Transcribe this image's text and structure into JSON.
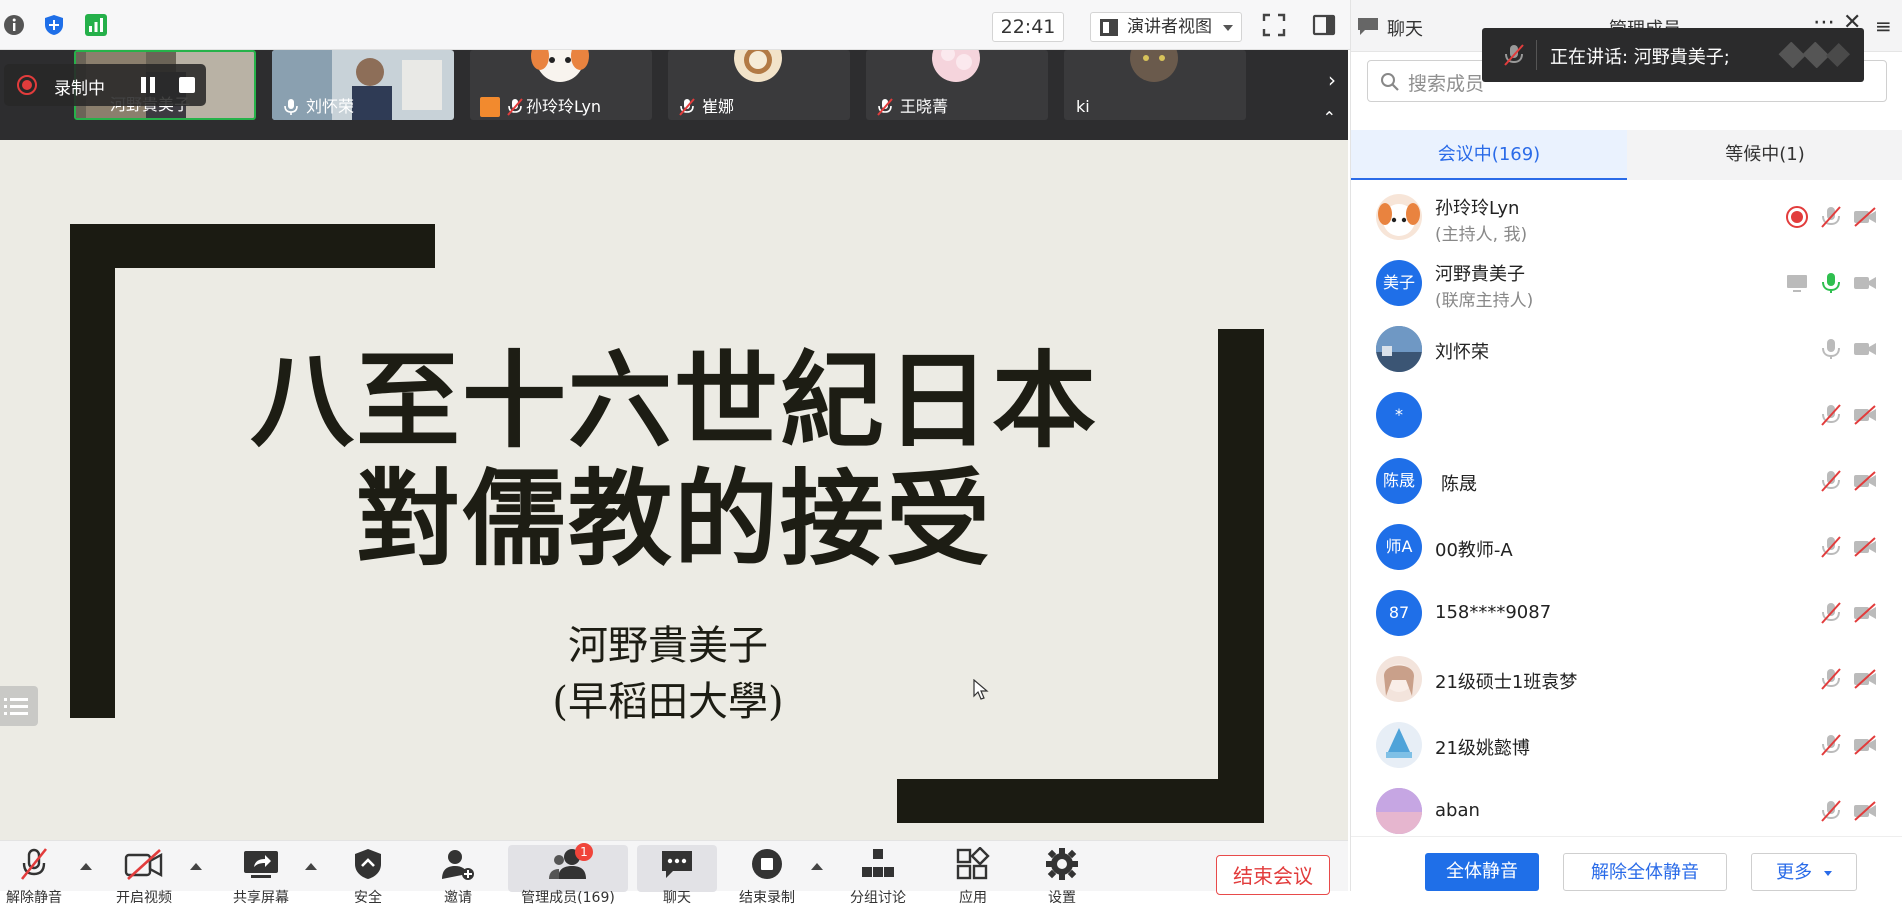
{
  "topbar": {
    "time": "22:41",
    "view_label": "演讲者视图"
  },
  "recording": {
    "label": "录制中"
  },
  "video_strip": {
    "tiles": [
      {
        "name": "河野貴美子"
      },
      {
        "name": "刘怀荣"
      },
      {
        "name": "孙玲玲Lyn"
      },
      {
        "name": "崔娜"
      },
      {
        "name": "王晓菁"
      },
      {
        "name": "ki"
      }
    ]
  },
  "slide": {
    "title_line1": "八至十六世紀日本",
    "title_line2": "對儒教的接受",
    "author": "河野貴美子",
    "affiliation": "(早稻田大學)"
  },
  "toolbar": {
    "buttons": [
      {
        "label": "解除静音"
      },
      {
        "label": "开启视频"
      },
      {
        "label": "共享屏幕"
      },
      {
        "label": "安全"
      },
      {
        "label": "邀请"
      },
      {
        "label": "管理成员(169)"
      },
      {
        "label": "聊天"
      },
      {
        "label": "结束录制"
      },
      {
        "label": "分组讨论"
      },
      {
        "label": "应用"
      },
      {
        "label": "设置"
      }
    ],
    "members_badge": "1",
    "end_meeting": "结束会议"
  },
  "panel": {
    "chat_tab": "聊天",
    "manage_tab": "管理成员",
    "search_placeholder": "搜索成员",
    "tab_in_meeting": "会议中(169)",
    "tab_waiting": "等候中(1)",
    "speaking_text": "正在讲话: 河野貴美子;",
    "members": [
      {
        "name": "孙玲玲Lyn",
        "role": "(主持人, 我)",
        "avatar": ""
      },
      {
        "name": "河野貴美子",
        "role": "(联席主持人)",
        "avatar": "美子"
      },
      {
        "name": "刘怀荣",
        "role": "",
        "avatar": ""
      },
      {
        "name": "",
        "role": "",
        "avatar": "*"
      },
      {
        "name": "陈晟",
        "role": "",
        "avatar": "陈晟"
      },
      {
        "name": "00教师-A",
        "role": "",
        "avatar": "师A"
      },
      {
        "name": "158****9087",
        "role": "",
        "avatar": "87"
      },
      {
        "name": "21级硕士1班袁梦",
        "role": "",
        "avatar": ""
      },
      {
        "name": "21级姚懿博",
        "role": "",
        "avatar": ""
      },
      {
        "name": "aban",
        "role": "",
        "avatar": ""
      }
    ],
    "footer": {
      "mute_all": "全体静音",
      "unmute_all": "解除全体静音",
      "more": "更多"
    }
  },
  "colors": {
    "accent": "#1f6fe8",
    "danger": "#e23c3c",
    "slide_bg": "#ecebe4",
    "slide_ink": "#1b1b12"
  }
}
